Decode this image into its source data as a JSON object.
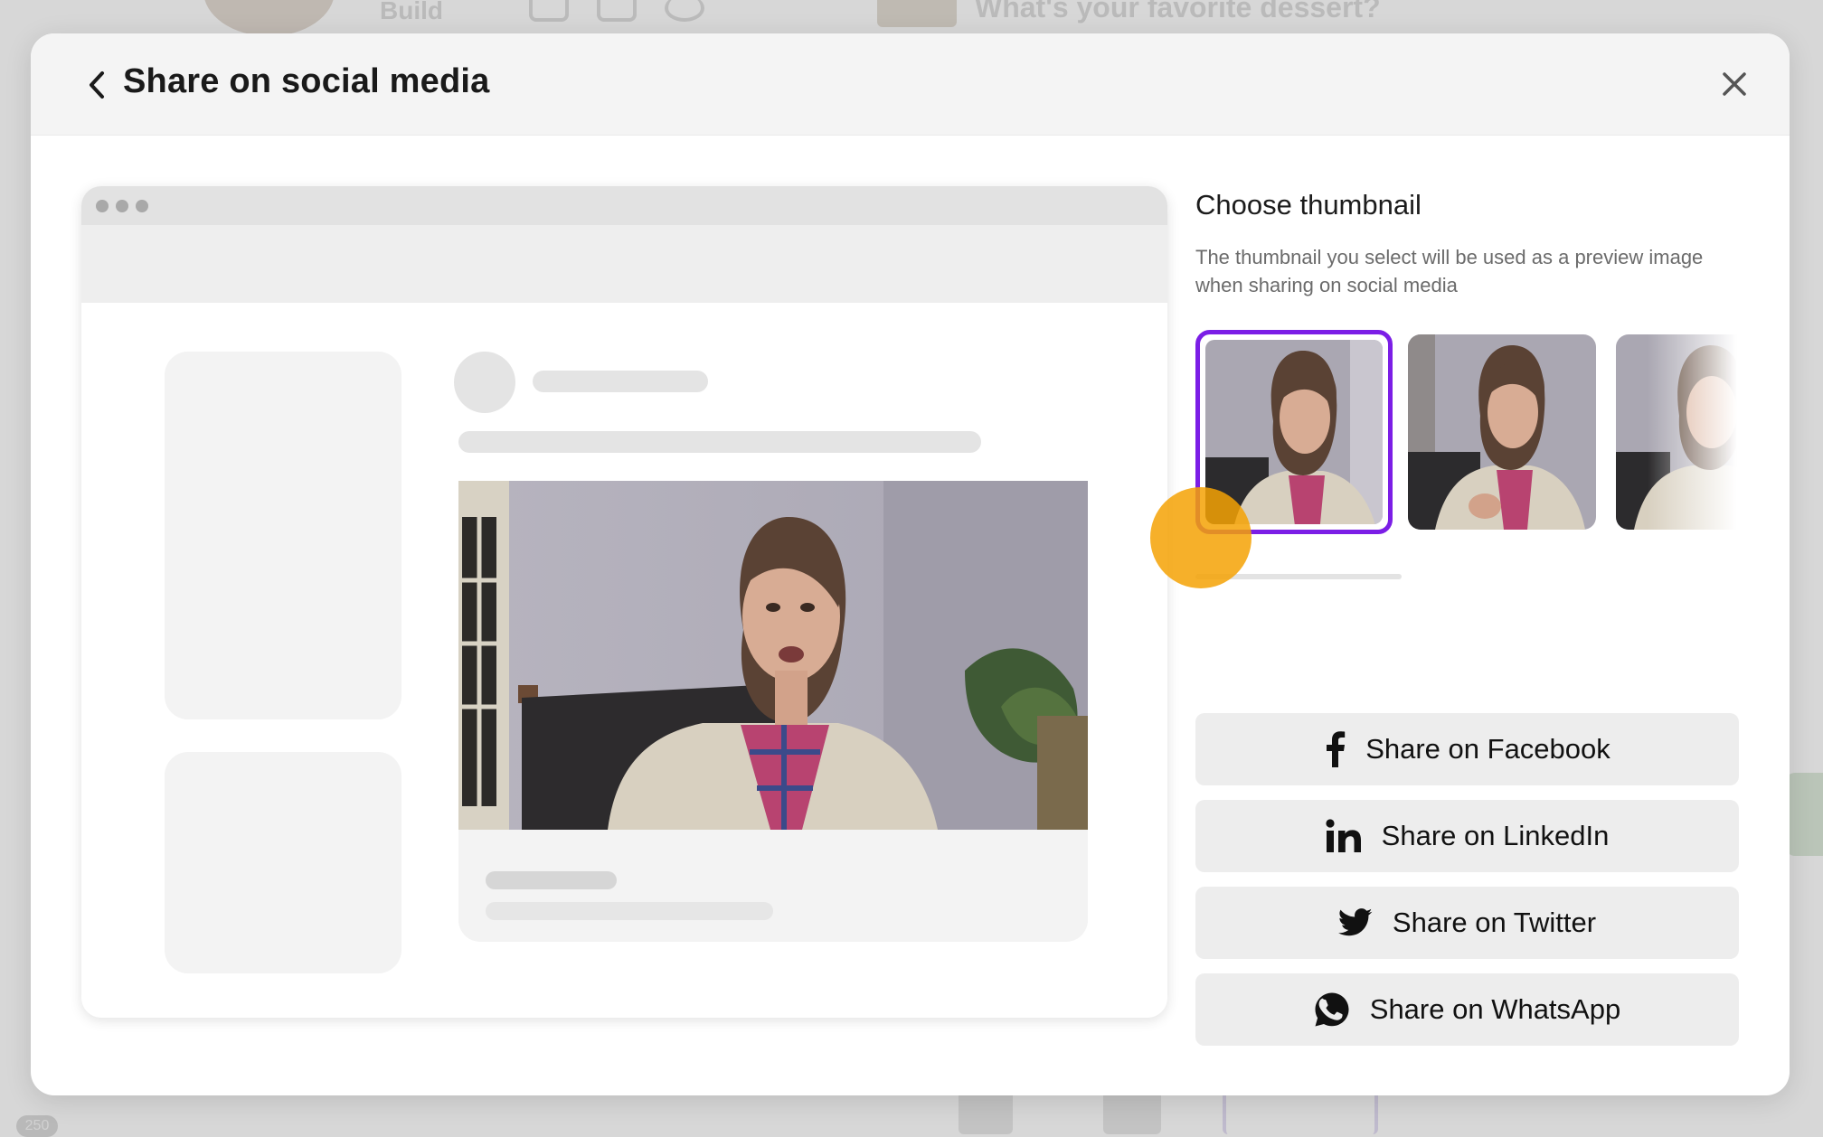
{
  "background": {
    "toolbar_build_label": "Build",
    "question_text": "What's your favorite dessert?"
  },
  "modal": {
    "title": "Share on social media"
  },
  "thumbnails": {
    "heading": "Choose thumbnail",
    "description": "The thumbnail you select will be used as a preview image when sharing on social media",
    "selected_index": 0
  },
  "share_buttons": [
    {
      "label": "Share on Facebook",
      "icon": "facebook-icon"
    },
    {
      "label": "Share on LinkedIn",
      "icon": "linkedin-icon"
    },
    {
      "label": "Share on Twitter",
      "icon": "twitter-icon"
    },
    {
      "label": "Share on WhatsApp",
      "icon": "whatsapp-icon"
    }
  ],
  "colors": {
    "accent": "#7b1ee6",
    "click_indicator": "#f5a205",
    "button_bg": "#ededed"
  }
}
